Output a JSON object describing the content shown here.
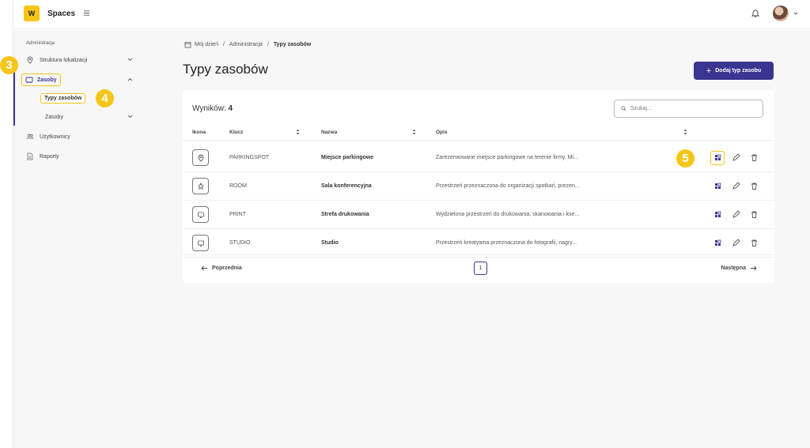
{
  "app": {
    "logo_letter": "W",
    "name": "Spaces"
  },
  "breadcrumb": {
    "home": "Mój dzień",
    "section": "Administracja",
    "current": "Typy zasobów"
  },
  "sidebar": {
    "section_label": "Administracja",
    "items": [
      {
        "label": "Struktura lokalizacji",
        "icon": "location-pin-icon"
      },
      {
        "label": "Zasoby",
        "icon": "resource-icon"
      },
      {
        "label": "Typy zasobów"
      },
      {
        "label": "Zasoby"
      },
      {
        "label": "Użytkownicy",
        "icon": "users-icon"
      },
      {
        "label": "Raporty",
        "icon": "report-icon"
      }
    ]
  },
  "markers": {
    "m3": "3",
    "m4": "4",
    "m5": "5"
  },
  "page": {
    "title": "Typy zasobów",
    "add_button": "Dodaj typ zasobu"
  },
  "table": {
    "results_label": "Wyników:",
    "results_count": "4",
    "search_placeholder": "Szukaj...",
    "columns": [
      "Ikona",
      "Klucz",
      "Nazwa",
      "Opis"
    ],
    "rows": [
      {
        "icon": "parking-icon",
        "key": "PARKINGSPOT",
        "name": "Miejsce parkingowe",
        "desc": "Zarezerwowane miejsce parkingowe na terenie firmy. Mi..."
      },
      {
        "icon": "meeting-room-icon",
        "key": "ROOM",
        "name": "Sala konferencyjna",
        "desc": "Przestrzeń przeznaczona do organizacji spotkań, prezen..."
      },
      {
        "icon": "monitor-icon",
        "key": "PRINT",
        "name": "Strefa drukowania",
        "desc": "Wydzielona przestrzeń do drukowania, skanowania i kse..."
      },
      {
        "icon": "monitor-icon",
        "key": "STUDIO",
        "name": "Studio",
        "desc": "Przestrzeń kreatywna przeznaczona do fotografii, nagry..."
      }
    ]
  },
  "pager": {
    "prev": "Poprzednia",
    "next": "Następna",
    "page": "1"
  },
  "colors": {
    "accent": "#3b3592",
    "highlight": "#f5c518"
  }
}
